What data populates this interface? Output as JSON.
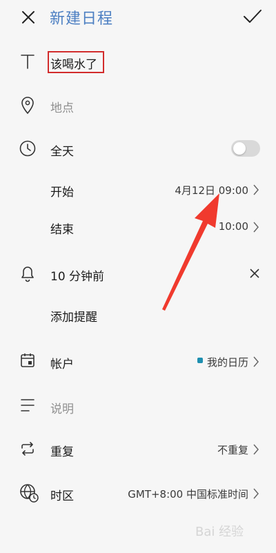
{
  "header": {
    "title": "新建日程"
  },
  "event": {
    "title_value": "该喝水了",
    "location_placeholder": "地点"
  },
  "all_day": {
    "label": "全天",
    "enabled": false
  },
  "start": {
    "label": "开始",
    "value": "4月12日 09:00"
  },
  "end": {
    "label": "结束",
    "value": "10:00"
  },
  "reminder": {
    "value": "10 分钟前",
    "add_label": "添加提醒"
  },
  "account": {
    "label": "帐户",
    "value": "我的日历",
    "color": "#1e8fb0"
  },
  "description": {
    "placeholder": "说明"
  },
  "repeat": {
    "label": "重复",
    "value": "不重复"
  },
  "timezone": {
    "label": "时区",
    "value": "GMT+8:00 中国标准时间"
  },
  "annotation": {
    "highlight_color": "#d22b2b",
    "arrow_color": "#f03a2e"
  },
  "watermark": {
    "text": "Bai 经验"
  }
}
